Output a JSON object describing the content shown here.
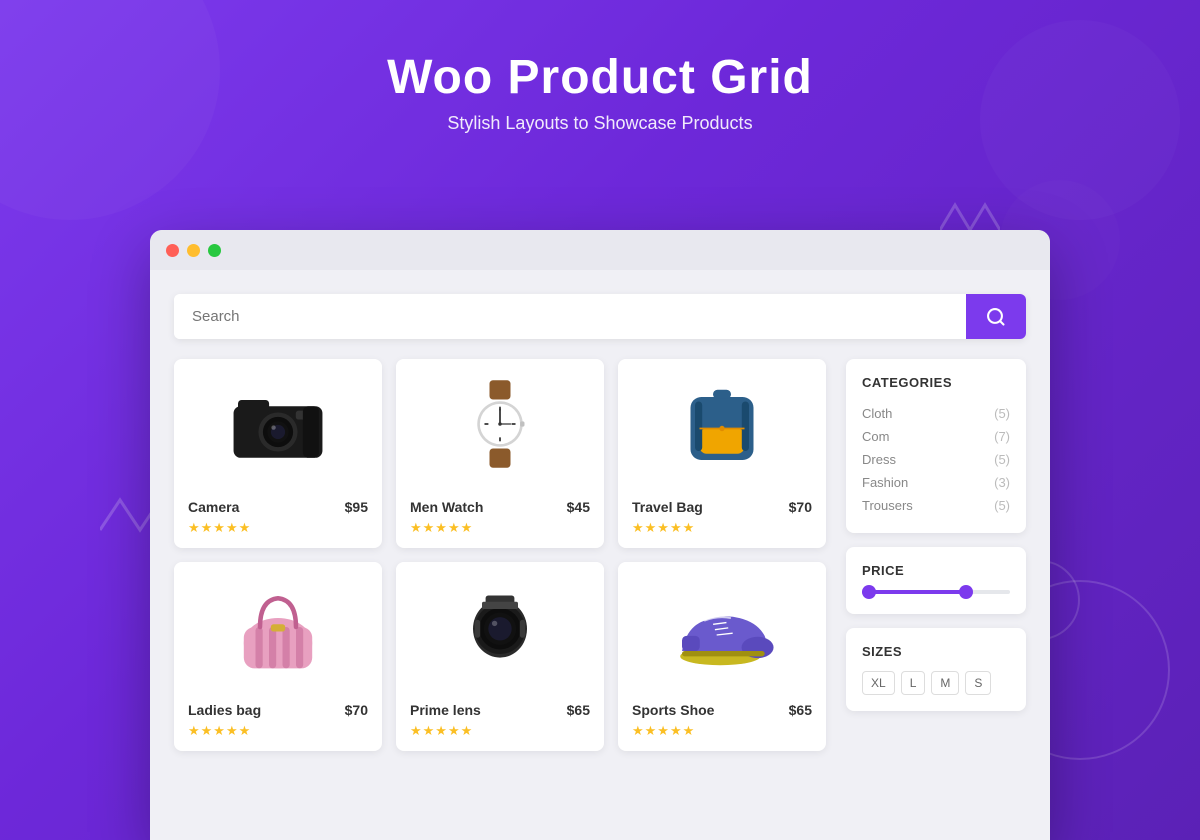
{
  "header": {
    "title": "Woo Product Grid",
    "subtitle": "Stylish Layouts to Showcase Products"
  },
  "search": {
    "placeholder": "Search"
  },
  "products": [
    {
      "id": 1,
      "name": "Camera",
      "price": "$95",
      "stars": 5,
      "emoji": "📷"
    },
    {
      "id": 2,
      "name": "Men Watch",
      "price": "$45",
      "stars": 5,
      "emoji": "⌚"
    },
    {
      "id": 3,
      "name": "Travel Bag",
      "price": "$70",
      "stars": 5,
      "emoji": "🎒"
    },
    {
      "id": 4,
      "name": "Ladies bag",
      "price": "$70",
      "stars": 5,
      "emoji": "👜"
    },
    {
      "id": 5,
      "name": "Prime lens",
      "price": "$65",
      "stars": 5,
      "emoji": "🔭"
    },
    {
      "id": 6,
      "name": "Sports Shoe",
      "price": "$65",
      "stars": 5,
      "emoji": "👟"
    }
  ],
  "categories": {
    "title": "CATEGORIES",
    "items": [
      {
        "name": "Cloth",
        "count": "(5)"
      },
      {
        "name": "Com",
        "count": "(7)"
      },
      {
        "name": "Dress",
        "count": "(5)"
      },
      {
        "name": "Fashion",
        "count": "(3)"
      },
      {
        "name": "Trousers",
        "count": "(5)"
      }
    ]
  },
  "price": {
    "title": "PRICE"
  },
  "sizes": {
    "title": "SIZES",
    "options": [
      "XL",
      "L",
      "M",
      "S"
    ]
  },
  "browser": {
    "dots": [
      "red",
      "yellow",
      "green"
    ]
  },
  "accent_color": "#7c3aed"
}
